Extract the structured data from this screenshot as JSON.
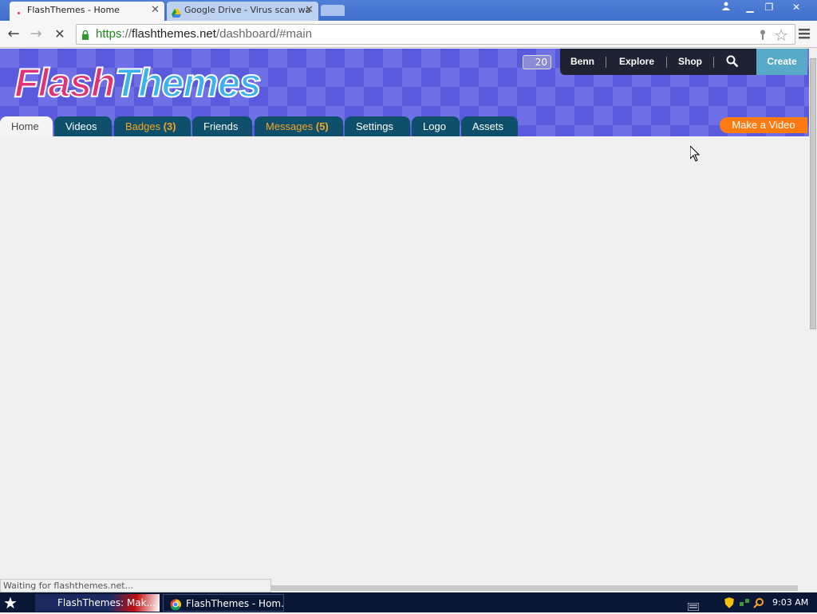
{
  "browser": {
    "tabs": [
      {
        "title": "FlashThemes - Home"
      },
      {
        "title": "Google Drive - Virus scan wa"
      }
    ],
    "url": {
      "scheme": "https",
      "sep": "://",
      "host": "flashthemes.net",
      "path": "/dashboard/#main"
    },
    "status_text": "Waiting for flashthemes.net..."
  },
  "site": {
    "logo_part1": "Flash",
    "logo_part2": "Themes",
    "counter": "20",
    "nav": {
      "user": "Benn",
      "explore": "Explore",
      "shop": "Shop",
      "create": "Create"
    },
    "tabs": [
      {
        "label": "Home"
      },
      {
        "label": "Videos"
      },
      {
        "label": "Badges",
        "count": "(3)"
      },
      {
        "label": "Friends"
      },
      {
        "label": "Messages",
        "count": "(5)"
      },
      {
        "label": "Settings"
      },
      {
        "label": "Logo"
      },
      {
        "label": "Assets"
      }
    ],
    "make_video": "Make a Video"
  },
  "taskbar": {
    "task1": "FlashThemes: Mak...",
    "task2": "FlashThemes - Hom...",
    "clock": "9:03 AM"
  },
  "colors": {
    "brand_orange": "#ff7a10",
    "tab_teal": "#0e4f6c",
    "banner": "#6f6fe6"
  }
}
